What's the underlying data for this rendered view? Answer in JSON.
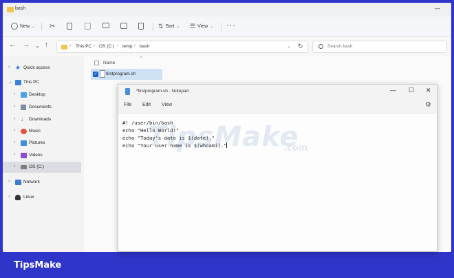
{
  "explorer": {
    "title": "bash",
    "command_bar": {
      "new_label": "New",
      "sort_label": "Sort",
      "view_label": "View",
      "more_label": "···"
    },
    "address": {
      "crumbs": [
        "This PC",
        "OS (C:)",
        "temp",
        "bash"
      ],
      "separator": "›"
    },
    "search": {
      "placeholder": "Search bash"
    },
    "sidebar": {
      "items": [
        {
          "label": "Quick access",
          "icon": "star-icon",
          "color": "#2f6fd1"
        },
        {
          "label": "This PC",
          "icon": "computer-icon",
          "color": "#3b82d6"
        },
        {
          "label": "Desktop",
          "icon": "desktop-icon",
          "color": "#4aa3e8"
        },
        {
          "label": "Documents",
          "icon": "documents-icon",
          "color": "#7a8aa0"
        },
        {
          "label": "Downloads",
          "icon": "download-icon",
          "color": "#2c9a4a"
        },
        {
          "label": "Music",
          "icon": "music-icon",
          "color": "#e0553a"
        },
        {
          "label": "Pictures",
          "icon": "pictures-icon",
          "color": "#3e8ee0"
        },
        {
          "label": "Videos",
          "icon": "videos-icon",
          "color": "#8a4fd1"
        },
        {
          "label": "OS (C:)",
          "icon": "drive-icon",
          "color": "#7c7c7c"
        },
        {
          "label": "Network",
          "icon": "network-icon",
          "color": "#3b7bd0"
        },
        {
          "label": "Linux",
          "icon": "linux-icon",
          "color": "#333333"
        }
      ]
    },
    "content": {
      "column_name": "Name",
      "files": [
        {
          "name": "firstprogram.sh",
          "selected": true
        }
      ]
    }
  },
  "notepad": {
    "title": "*firstprogram.sh - Notepad",
    "menu": [
      "File",
      "Edit",
      "View"
    ],
    "lines": [
      "#! /user/bin/bash",
      "echo \"Hello World!\"",
      "echo \"Today's date is $(date).\"",
      "echo \"Your user name is $(whoami)."
    ],
    "caret_after": "\""
  },
  "watermark": {
    "main": "TipsMake",
    "suffix": ".com"
  },
  "brand": "TipsMake"
}
